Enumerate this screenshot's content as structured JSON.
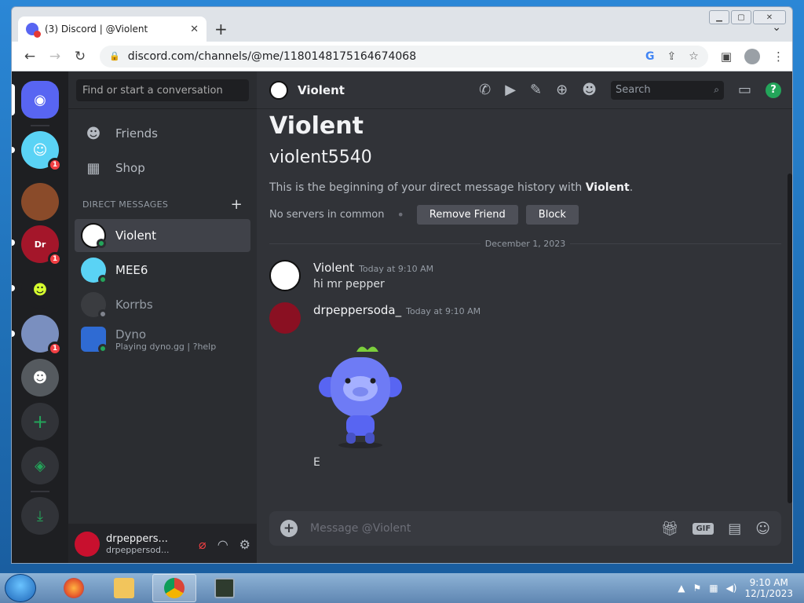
{
  "browser": {
    "tab_title": "(3) Discord | @Violent",
    "url": "discord.com/channels/@me/1180148175164674068"
  },
  "guilds": {
    "badges": [
      "1",
      "1",
      "1"
    ]
  },
  "dm_sidebar": {
    "search_placeholder": "Find or start a conversation",
    "nav": [
      {
        "label": "Friends",
        "icon": "friends-icon"
      },
      {
        "label": "Shop",
        "icon": "shop-icon"
      }
    ],
    "dm_header": "DIRECT MESSAGES",
    "dms": [
      {
        "name": "Violent",
        "status": "online",
        "active": true
      },
      {
        "name": "MEE6",
        "status": "online"
      },
      {
        "name": "Korrbs",
        "status": "offline"
      },
      {
        "name": "Dyno",
        "sub": "Playing dyno.gg | ?help",
        "status": "online"
      }
    ],
    "user": {
      "name": "drpeppers...",
      "tag": "drpeppersod..."
    }
  },
  "channel": {
    "name": "Violent",
    "search_placeholder": "Search"
  },
  "intro": {
    "title": "Violent",
    "tag": "violent5540",
    "text_prefix": "This is the beginning of your direct message history with ",
    "text_name": "Violent",
    "text_suffix": ".",
    "servers": "No servers in common",
    "remove_btn": "Remove Friend",
    "block_btn": "Block"
  },
  "divider_date": "December 1, 2023",
  "messages": [
    {
      "author": "Violent",
      "time": "Today at 9:10 AM",
      "text": "hi mr pepper"
    },
    {
      "author": "drpeppersoda_",
      "time": "Today at 9:10 AM",
      "text": ""
    }
  ],
  "trailing_message": "E",
  "composer": {
    "placeholder": "Message @Violent"
  },
  "taskbar": {
    "time": "9:10 AM",
    "date": "12/1/2023"
  },
  "colors": {
    "blurple": "#5865f2",
    "online": "#23a55a",
    "badge": "#f23f43"
  }
}
